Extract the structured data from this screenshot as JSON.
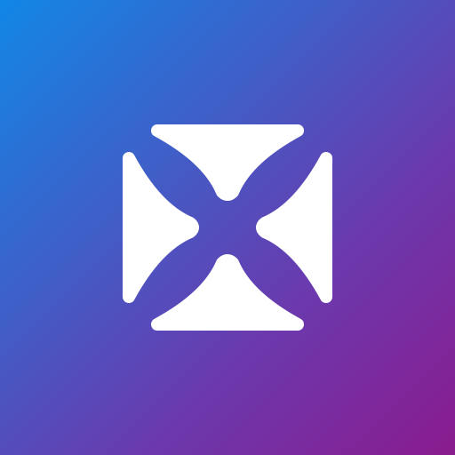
{
  "app_icon": {
    "icon": "four-triangle-x-logo-icon",
    "colors": {
      "gradient_start": "#1187e6",
      "gradient_mid_1": "#3f5fc8",
      "gradient_mid_2": "#6a3aae",
      "gradient_end": "#8a1b8e",
      "mark": "#ffffff"
    }
  }
}
